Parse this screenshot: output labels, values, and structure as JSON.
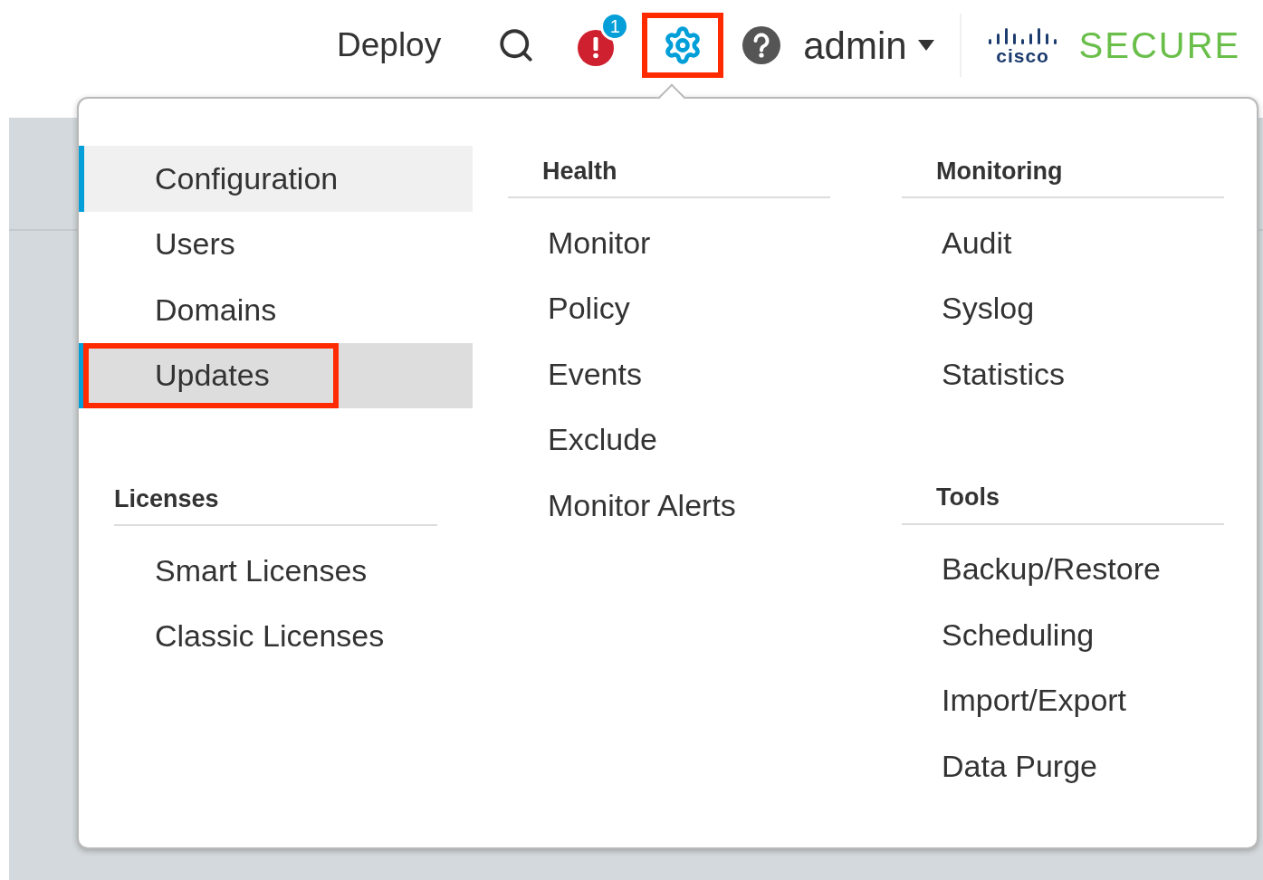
{
  "header": {
    "deploy": "Deploy",
    "alerts": {
      "count": "1"
    },
    "settings": {
      "highlighted": true
    },
    "user": {
      "name": "admin"
    },
    "brand": {
      "company": "cisco",
      "product": "SECURE"
    }
  },
  "menu": {
    "columns": [
      {
        "sections": [
          {
            "items": [
              {
                "label": "Configuration",
                "selected": true,
                "hovered": false,
                "highlighted": false
              },
              {
                "label": "Users",
                "selected": false,
                "hovered": false,
                "highlighted": false
              },
              {
                "label": "Domains",
                "selected": false,
                "hovered": false,
                "highlighted": false
              },
              {
                "label": "Updates",
                "selected": false,
                "hovered": true,
                "highlighted": true
              }
            ]
          },
          {
            "heading": "Licenses",
            "items": [
              {
                "label": "Smart Licenses",
                "selected": false,
                "hovered": false,
                "highlighted": false
              },
              {
                "label": "Classic Licenses",
                "selected": false,
                "hovered": false,
                "highlighted": false
              }
            ]
          }
        ]
      },
      {
        "sections": [
          {
            "heading": "Health",
            "items": [
              {
                "label": "Monitor",
                "selected": false,
                "hovered": false,
                "highlighted": false
              },
              {
                "label": "Policy",
                "selected": false,
                "hovered": false,
                "highlighted": false
              },
              {
                "label": "Events",
                "selected": false,
                "hovered": false,
                "highlighted": false
              },
              {
                "label": "Exclude",
                "selected": false,
                "hovered": false,
                "highlighted": false
              },
              {
                "label": "Monitor Alerts",
                "selected": false,
                "hovered": false,
                "highlighted": false
              }
            ]
          }
        ]
      },
      {
        "sections": [
          {
            "heading": "Monitoring",
            "items": [
              {
                "label": "Audit",
                "selected": false,
                "hovered": false,
                "highlighted": false
              },
              {
                "label": "Syslog",
                "selected": false,
                "hovered": false,
                "highlighted": false
              },
              {
                "label": "Statistics",
                "selected": false,
                "hovered": false,
                "highlighted": false
              }
            ]
          },
          {
            "heading": "Tools",
            "items": [
              {
                "label": "Backup/Restore",
                "selected": false,
                "hovered": false,
                "highlighted": false
              },
              {
                "label": "Scheduling",
                "selected": false,
                "hovered": false,
                "highlighted": false
              },
              {
                "label": "Import/Export",
                "selected": false,
                "hovered": false,
                "highlighted": false
              },
              {
                "label": "Data Purge",
                "selected": false,
                "hovered": false,
                "highlighted": false
              }
            ]
          }
        ]
      }
    ]
  }
}
